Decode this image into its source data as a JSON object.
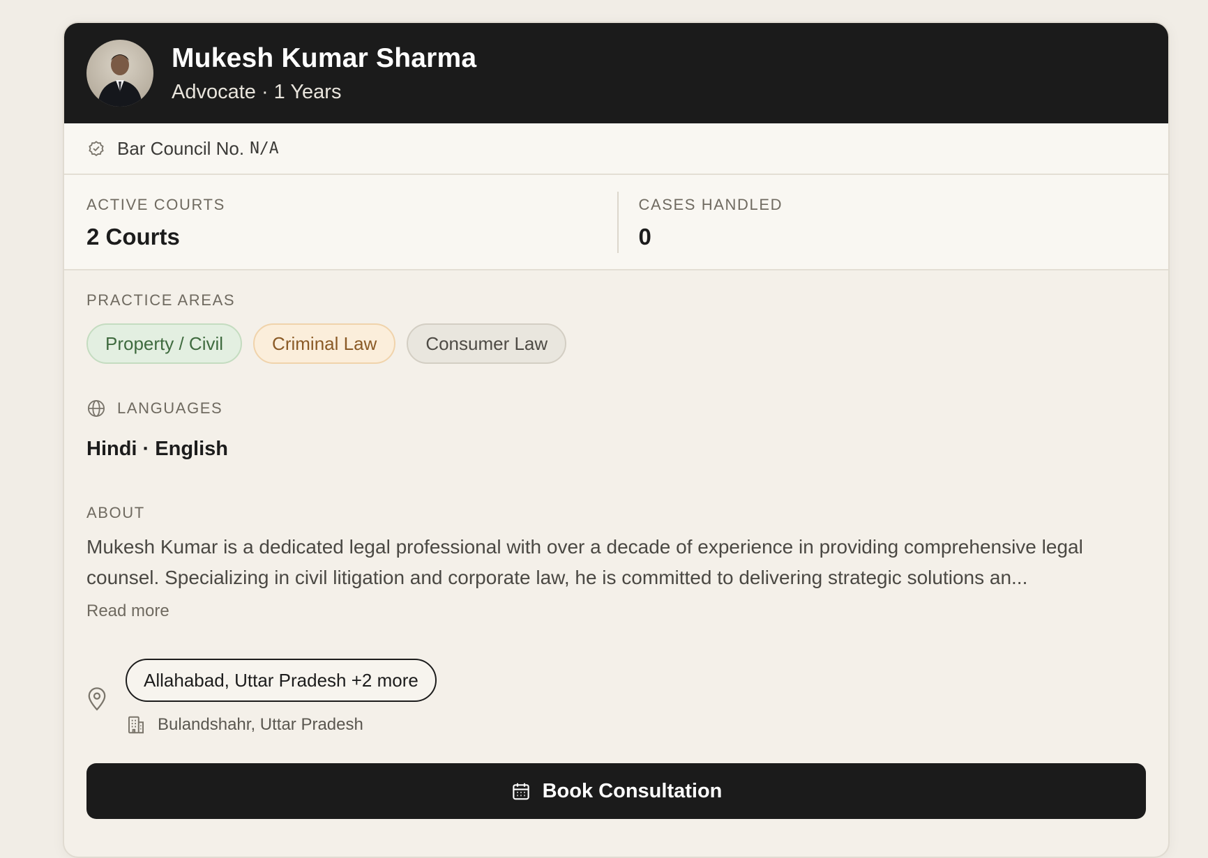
{
  "profile": {
    "name": "Mukesh Kumar Sharma",
    "subtitle": "Advocate · 1 Years"
  },
  "bar_council": {
    "label": "Bar Council No.",
    "value": "N/A"
  },
  "stats": {
    "active_courts_label": "ACTIVE COURTS",
    "active_courts_value": "2 Courts",
    "cases_label": "CASES HANDLED",
    "cases_value": "0"
  },
  "practice_areas": {
    "label": "PRACTICE AREAS",
    "items": [
      "Property / Civil",
      "Criminal Law",
      "Consumer Law"
    ]
  },
  "languages": {
    "label": "LANGUAGES",
    "value": "Hindi · English"
  },
  "about": {
    "label": "ABOUT",
    "text": "Mukesh Kumar is a dedicated legal professional with over a decade of experience in providing comprehensive legal counsel. Specializing in civil litigation and corporate law, he is committed to delivering strategic solutions an...",
    "read_more": "Read more"
  },
  "location": {
    "primary": "Allahabad, Uttar Pradesh +2 more",
    "court": "Bulandshahr, Uttar Pradesh"
  },
  "actions": {
    "book_label": "Book Consultation"
  },
  "colors": {
    "header_bg": "#1b1b1b",
    "card_bg": "#f4f0e9",
    "pill_green": "#e3efe1",
    "pill_orange": "#fbeedb",
    "pill_gray": "#e9e6de"
  }
}
